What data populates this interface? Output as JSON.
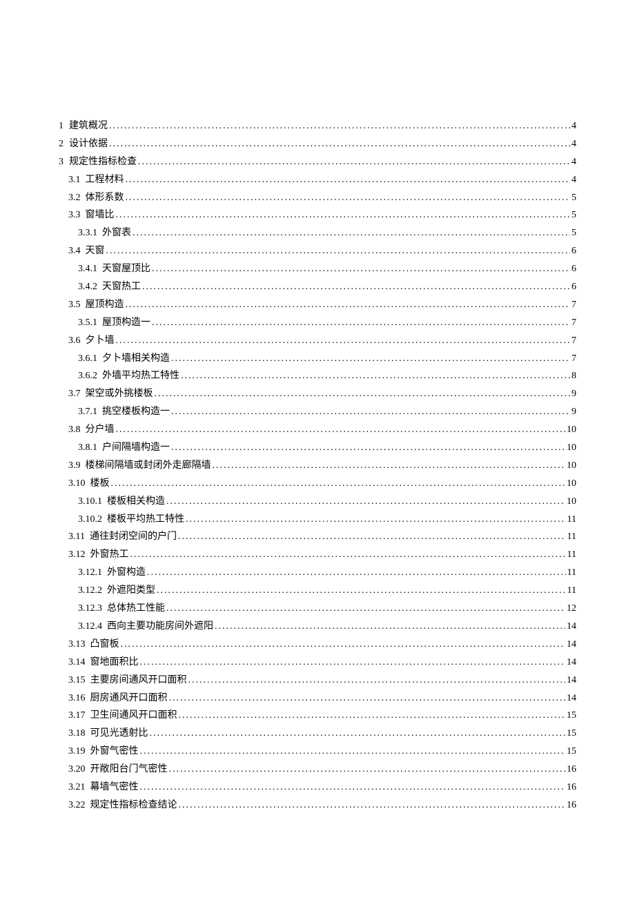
{
  "toc": [
    {
      "num": "1",
      "title": "建筑概况",
      "page": "4",
      "level": 0,
      "top": true
    },
    {
      "num": "2",
      "title": "设计依据",
      "page": "4",
      "level": 0,
      "top": true
    },
    {
      "num": "3",
      "title": "规定性指标检查",
      "page": "4",
      "level": 0,
      "top": true
    },
    {
      "num": "3.1",
      "title": "工程材料",
      "page": "4",
      "level": 1
    },
    {
      "num": "3.2",
      "title": "体形系数",
      "page": "5",
      "level": 1
    },
    {
      "num": "3.3",
      "title": "窗墙比",
      "page": "5",
      "level": 1
    },
    {
      "num": "3.3.1",
      "title": "外窗表",
      "page": "5",
      "level": 2
    },
    {
      "num": "3.4",
      "title": "天窗",
      "page": "6",
      "level": 1
    },
    {
      "num": "3.4.1",
      "title": "天窗屋顶比",
      "page": "6",
      "level": 2
    },
    {
      "num": "3.4.2",
      "title": "天窗热工",
      "page": "6",
      "level": 2
    },
    {
      "num": "3.5",
      "title": "屋顶构造",
      "page": "7",
      "level": 1
    },
    {
      "num": "3.5.1",
      "title": "屋顶构造一",
      "page": "7",
      "level": 2
    },
    {
      "num": "3.6",
      "title": "夕卜墙",
      "page": "7",
      "level": 1
    },
    {
      "num": "3.6.1",
      "title": "夕卜墙相关构造",
      "page": "7",
      "level": 2
    },
    {
      "num": "3.6.2",
      "title": "外墙平均热工特性",
      "page": "8",
      "level": 2
    },
    {
      "num": "3.7",
      "title": "架空或外挑楼板",
      "page": "9",
      "level": 1
    },
    {
      "num": "3.7.1",
      "title": "挑空楼板构造一",
      "page": "9",
      "level": 2
    },
    {
      "num": "3.8",
      "title": "分户墙",
      "page": "10",
      "level": 1
    },
    {
      "num": "3.8.1",
      "title": "户间隔墙构造一",
      "page": "10",
      "level": 2
    },
    {
      "num": "3.9",
      "title": "楼梯间隔墙或封闭外走廊隔墙",
      "page": "10",
      "level": 1
    },
    {
      "num": "3.10",
      "title": "楼板",
      "page": "10",
      "level": 1
    },
    {
      "num": "3.10.1",
      "title": "楼板相关构造",
      "page": "10",
      "level": 2
    },
    {
      "num": "3.10.2",
      "title": "楼板平均热工特性",
      "page": "11",
      "level": 2
    },
    {
      "num": "3.11",
      "title": "通往封闭空间的户门",
      "page": "11",
      "level": 1
    },
    {
      "num": "3.12",
      "title": "外窗热工",
      "page": "11",
      "level": 1
    },
    {
      "num": "3.12.1",
      "title": "外窗构造",
      "page": "11",
      "level": 2
    },
    {
      "num": "3.12.2",
      "title": "外遮阳类型",
      "page": "11",
      "level": 2
    },
    {
      "num": "3.12.3",
      "title": "总体热工性能",
      "page": "12",
      "level": 2
    },
    {
      "num": "3.12.4",
      "title": "西向主要功能房间外遮阳",
      "page": "14",
      "level": 2
    },
    {
      "num": "3.13",
      "title": "凸窗板",
      "page": "14",
      "level": 1
    },
    {
      "num": "3.14",
      "title": "窗地面积比",
      "page": "14",
      "level": 1
    },
    {
      "num": "3.15",
      "title": "主要房间通风开口面积",
      "page": "14",
      "level": 1
    },
    {
      "num": "3.16",
      "title": "厨房通风开口面积",
      "page": "14",
      "level": 1
    },
    {
      "num": "3.17",
      "title": "卫生间通风开口面积",
      "page": "15",
      "level": 1
    },
    {
      "num": "3.18",
      "title": "可见光透射比",
      "page": "15",
      "level": 1
    },
    {
      "num": "3.19",
      "title": "外窗气密性",
      "page": "15",
      "level": 1
    },
    {
      "num": "3.20",
      "title": "开敞阳台门气密性",
      "page": "16",
      "level": 1
    },
    {
      "num": "3.21",
      "title": "幕墙气密性",
      "page": "16",
      "level": 1
    },
    {
      "num": "3.22",
      "title": "规定性指标检查结论",
      "page": "16",
      "level": 1
    }
  ]
}
